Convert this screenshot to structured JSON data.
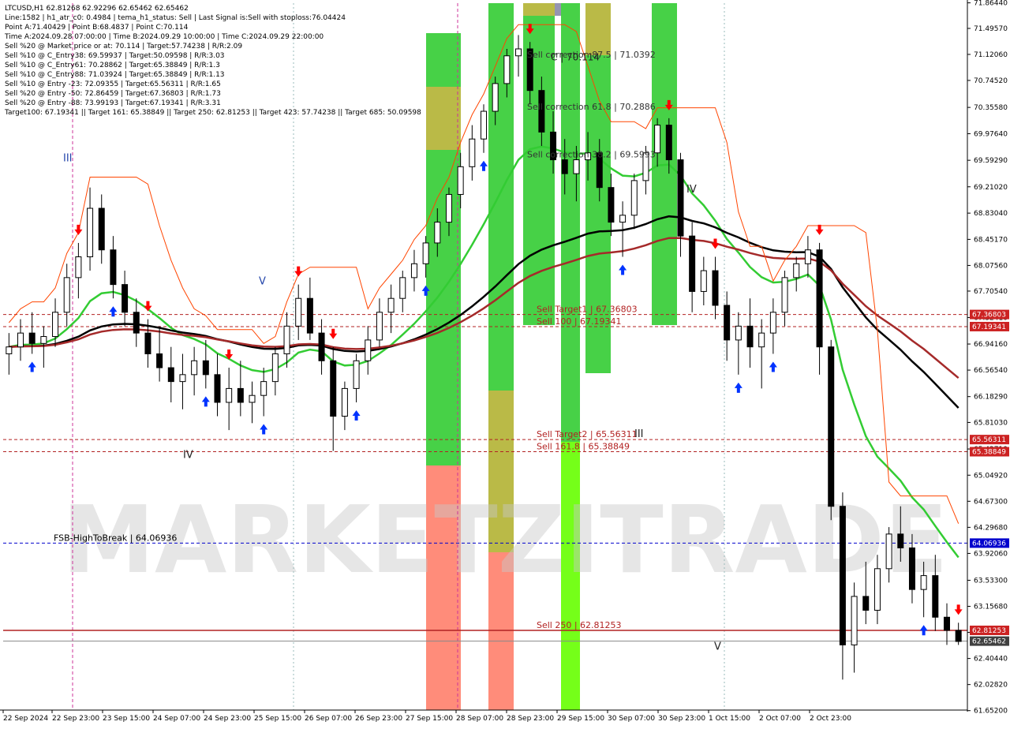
{
  "header": {
    "lines": [
      "LTCUSD,H1  62.81268 62.92296 62.65462 62.65462",
      "Line:1582  |  h1_atr_c0: 0.4984  |  tema_h1_status: Sell  |  Last Signal is:Sell with stoploss:76.04424",
      "Point A:71.40429  |  Point B:68.4837  |  Point C:70.114",
      "Time A:2024.09.28 07:00:00  |  Time B:2024.09.29 10:00:00  |  Time C:2024.09.29 22:00:00",
      "Sell %20 @ Market price or at: 70.114  |  Target:57.74238  |  R/R:2.09",
      "Sell %10 @ C_Entry38: 69.59937  |  Target:50.09598  |  R/R:3.03",
      "Sell %10 @ C_Entry61: 70.28862  |  Target:65.38849  |  R/R:1.3",
      "Sell %10 @ C_Entry88: 71.03924  |  Target:65.38849  |  R/R:1.13",
      "Sell %10 @ Entry -23: 72.09355  |  Target:65.56311  |  R/R:1.65",
      "Sell %20 @ Entry -50: 72.86459  |  Target:67.36803  |  R/R:1.73",
      "Sell %20 @ Entry -88: 73.99193  |  Target:67.19341  |  R/R:3.31",
      "Target100: 67.19341  ||  Target 161: 65.38849  ||  Target 250: 62.81253  ||  Target 423: 57.74238  ||  Target 685: 50.09598"
    ]
  },
  "watermark": "MARKETZITRADE",
  "colors": {
    "bg": "#ffffff",
    "green_bar": "#33cc33",
    "lime_bar": "#66ff00",
    "olive_bar": "#b3b333",
    "salmon_bar": "#ff7f6b",
    "ema_green": "#33cc33",
    "ma_black": "#000000",
    "ma_darkred": "#a52a2a",
    "envelope": "#ff4500",
    "level_dashed": "#b22222",
    "fsb_blue": "#0000cd",
    "badge_red": "#cc2222",
    "badge_blue": "#0000cd",
    "badge_gray": "#404040",
    "arrow_up": "#0033ff",
    "arrow_down": "#ff0000"
  },
  "chart_data": {
    "type": "candlestick",
    "symbol": "LTCUSD",
    "timeframe": "H1",
    "ylim": [
      61.66,
      71.86
    ],
    "x_labels": [
      "22 Sep 2024",
      "22 Sep 23:00",
      "23 Sep 15:00",
      "24 Sep 07:00",
      "24 Sep 23:00",
      "25 Sep 15:00",
      "26 Sep 07:00",
      "26 Sep 23:00",
      "27 Sep 15:00",
      "28 Sep 07:00",
      "28 Sep 23:00",
      "29 Sep 15:00",
      "30 Sep 07:00",
      "30 Sep 23:00",
      "1 Oct 15:00",
      "2 Oct 07:00",
      "2 Oct 23:00"
    ],
    "y_ticks": [
      "71.86440",
      "71.49570",
      "71.12060",
      "70.74520",
      "70.35580",
      "69.97640",
      "69.59290",
      "69.21020",
      "68.83040",
      "68.45170",
      "68.07560",
      "67.70540",
      "67.32410",
      "66.94160",
      "66.56540",
      "66.18290",
      "65.81030",
      "65.42710",
      "65.04920",
      "64.67300",
      "64.29680",
      "63.92060",
      "63.53300",
      "63.15680",
      "62.78060",
      "62.40440",
      "62.02820",
      "61.65200"
    ],
    "price_badges": [
      {
        "text": "67.36803",
        "value": 67.368,
        "kind": "red"
      },
      {
        "text": "67.19341",
        "value": 67.193,
        "kind": "red"
      },
      {
        "text": "65.56311",
        "value": 65.563,
        "kind": "red"
      },
      {
        "text": "65.38849",
        "value": 65.388,
        "kind": "red"
      },
      {
        "text": "64.06936",
        "value": 64.069,
        "kind": "blue"
      },
      {
        "text": "62.81253",
        "value": 62.81,
        "kind": "red"
      },
      {
        "text": "62.65462",
        "value": 62.655,
        "kind": "gray"
      }
    ],
    "level_lines": [
      {
        "label": "Sell Target1 | 67.36803",
        "value": 67.368,
        "style": "dashed"
      },
      {
        "label": "Sell 100 | 67.19341",
        "value": 67.193,
        "style": "dashed"
      },
      {
        "label": "Sell Target2 | 65.56311",
        "value": 65.563,
        "style": "dashed"
      },
      {
        "label": "Sell 161.8 | 65.38849",
        "value": 65.388,
        "style": "dashed"
      },
      {
        "label": "FSB-HighToBreak | 64.06936",
        "value": 64.069,
        "style": "blue-dashed"
      },
      {
        "label": "Sell 250 | 62.81253",
        "value": 62.81,
        "style": "solid"
      }
    ],
    "correction_labels": [
      {
        "text": "Sell correction 87.5 | 71.0392",
        "value": 71.04
      },
      {
        "text": "Sell correction 61.8 | 70.2886",
        "value": 70.29
      },
      {
        "text": "Sell correction 38.2 | 69.5993",
        "value": 69.6
      }
    ],
    "point_c_label": "C | 70.114",
    "wave_labels": [
      {
        "text": "III",
        "value": 69.58,
        "slot": 1
      },
      {
        "text": "V",
        "value": 67.8,
        "slot": 5
      },
      {
        "text": "IV",
        "value": 65.3,
        "slot": 3
      },
      {
        "text": "IV",
        "value": 69.13,
        "slot": 13
      },
      {
        "text": "III",
        "value": 65.6,
        "slot": 12
      },
      {
        "text": "V",
        "value": 62.53,
        "slot": 14
      }
    ],
    "candles": [
      [
        66.8,
        67.1,
        66.5,
        66.9
      ],
      [
        66.9,
        67.3,
        66.7,
        67.1
      ],
      [
        67.1,
        67.4,
        66.8,
        66.95
      ],
      [
        66.95,
        67.2,
        66.6,
        67.05
      ],
      [
        67.05,
        67.6,
        66.9,
        67.4
      ],
      [
        67.4,
        68.1,
        67.2,
        67.9
      ],
      [
        67.9,
        68.4,
        67.6,
        68.2
      ],
      [
        68.2,
        69.2,
        68.0,
        68.9
      ],
      [
        68.9,
        69.1,
        68.1,
        68.3
      ],
      [
        68.3,
        68.5,
        67.6,
        67.8
      ],
      [
        67.8,
        68.0,
        67.2,
        67.4
      ],
      [
        67.4,
        67.6,
        66.9,
        67.1
      ],
      [
        67.1,
        67.3,
        66.6,
        66.8
      ],
      [
        66.8,
        67.2,
        66.4,
        66.6
      ],
      [
        66.6,
        66.9,
        66.1,
        66.4
      ],
      [
        66.4,
        66.8,
        66.0,
        66.5
      ],
      [
        66.5,
        66.9,
        66.2,
        66.7
      ],
      [
        66.7,
        67.0,
        66.3,
        66.5
      ],
      [
        66.5,
        66.8,
        65.9,
        66.1
      ],
      [
        66.1,
        66.6,
        65.7,
        66.3
      ],
      [
        66.3,
        66.7,
        65.9,
        66.1
      ],
      [
        66.1,
        66.4,
        65.8,
        66.2
      ],
      [
        66.2,
        66.6,
        65.9,
        66.4
      ],
      [
        66.4,
        66.9,
        66.2,
        66.8
      ],
      [
        66.8,
        67.4,
        66.6,
        67.2
      ],
      [
        67.2,
        67.8,
        67.0,
        67.6
      ],
      [
        67.6,
        67.9,
        67.0,
        67.1
      ],
      [
        67.1,
        67.3,
        66.5,
        66.7
      ],
      [
        66.7,
        66.9,
        65.4,
        65.9
      ],
      [
        65.9,
        66.4,
        65.7,
        66.3
      ],
      [
        66.3,
        66.8,
        66.1,
        66.7
      ],
      [
        66.7,
        67.2,
        66.5,
        67.0
      ],
      [
        67.0,
        67.6,
        66.9,
        67.4
      ],
      [
        67.4,
        67.8,
        67.1,
        67.6
      ],
      [
        67.6,
        68.0,
        67.4,
        67.9
      ],
      [
        67.9,
        68.3,
        67.7,
        68.1
      ],
      [
        68.1,
        68.5,
        67.9,
        68.4
      ],
      [
        68.4,
        68.9,
        68.2,
        68.7
      ],
      [
        68.7,
        69.2,
        68.5,
        69.1
      ],
      [
        69.1,
        69.7,
        68.9,
        69.5
      ],
      [
        69.5,
        70.1,
        69.3,
        69.9
      ],
      [
        69.9,
        70.4,
        69.7,
        70.3
      ],
      [
        70.3,
        70.8,
        70.1,
        70.7
      ],
      [
        70.7,
        71.2,
        70.5,
        71.1
      ],
      [
        71.1,
        71.4,
        70.8,
        71.2
      ],
      [
        71.2,
        71.3,
        70.4,
        70.6
      ],
      [
        70.6,
        70.8,
        69.8,
        70.0
      ],
      [
        70.0,
        70.3,
        69.4,
        69.6
      ],
      [
        69.6,
        69.9,
        69.1,
        69.4
      ],
      [
        69.4,
        69.8,
        69.0,
        69.6
      ],
      [
        69.6,
        70.0,
        69.3,
        69.7
      ],
      [
        69.7,
        69.9,
        69.0,
        69.2
      ],
      [
        69.2,
        69.4,
        68.5,
        68.7
      ],
      [
        68.7,
        69.0,
        68.2,
        68.8
      ],
      [
        68.8,
        69.4,
        68.6,
        69.3
      ],
      [
        69.3,
        69.8,
        69.1,
        69.7
      ],
      [
        69.7,
        70.2,
        69.5,
        70.1
      ],
      [
        70.1,
        70.2,
        69.4,
        69.6
      ],
      [
        69.6,
        69.7,
        68.2,
        68.5
      ],
      [
        68.5,
        68.7,
        67.4,
        67.7
      ],
      [
        67.7,
        68.2,
        67.5,
        68.0
      ],
      [
        68.0,
        68.2,
        67.3,
        67.5
      ],
      [
        67.5,
        67.7,
        66.7,
        67.0
      ],
      [
        67.0,
        67.4,
        66.5,
        67.2
      ],
      [
        67.2,
        67.6,
        66.6,
        66.9
      ],
      [
        66.9,
        67.3,
        66.3,
        67.1
      ],
      [
        67.1,
        67.6,
        66.8,
        67.4
      ],
      [
        67.4,
        68.0,
        67.2,
        67.9
      ],
      [
        67.9,
        68.2,
        67.7,
        68.1
      ],
      [
        68.1,
        68.5,
        67.9,
        68.3
      ],
      [
        68.3,
        68.4,
        66.5,
        66.9
      ],
      [
        66.9,
        67.0,
        64.4,
        64.6
      ],
      [
        64.6,
        64.8,
        62.1,
        62.6
      ],
      [
        62.6,
        63.5,
        62.2,
        63.3
      ],
      [
        63.3,
        63.8,
        62.9,
        63.1
      ],
      [
        63.1,
        63.9,
        62.9,
        63.7
      ],
      [
        63.7,
        64.3,
        63.5,
        64.2
      ],
      [
        64.2,
        64.6,
        63.8,
        64.0
      ],
      [
        64.0,
        64.2,
        63.2,
        63.4
      ],
      [
        63.4,
        63.8,
        63.0,
        63.6
      ],
      [
        63.6,
        63.9,
        62.8,
        63.0
      ],
      [
        63.0,
        63.2,
        62.6,
        62.81
      ],
      [
        62.81,
        62.92,
        62.6,
        62.65
      ]
    ]
  }
}
